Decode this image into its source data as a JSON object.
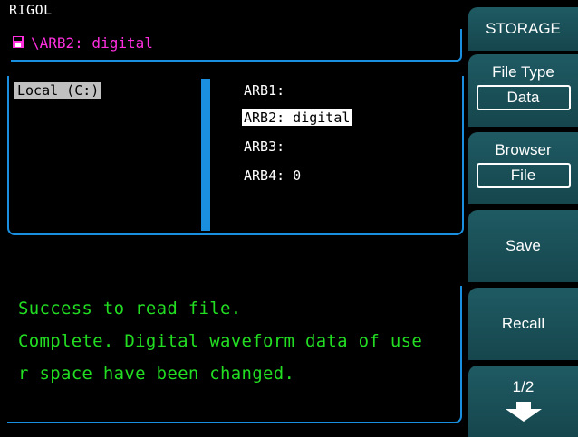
{
  "brand": "RIGOL",
  "path": {
    "text": "\\ARB2: digital",
    "icon": "disk-icon"
  },
  "browser": {
    "drive": "Local (C:)",
    "files": [
      "ARB1:",
      "ARB2: digital",
      "ARB3:",
      "ARB4: 0"
    ],
    "selected_index": 1
  },
  "messages": [
    "Success to read file.",
    "Complete. Digital waveform data of use",
    "r space have been changed."
  ],
  "menu": {
    "title": "STORAGE",
    "file_type": {
      "label": "File Type",
      "value": "Data"
    },
    "browser": {
      "label": "Browser",
      "value": "File"
    },
    "save": "Save",
    "recall": "Recall",
    "page": "1/2"
  },
  "colors": {
    "accent": "#1a8fe0",
    "path_text": "#ff2fe0",
    "message_text": "#22dd22",
    "menu_bg": "#1f5a63"
  }
}
